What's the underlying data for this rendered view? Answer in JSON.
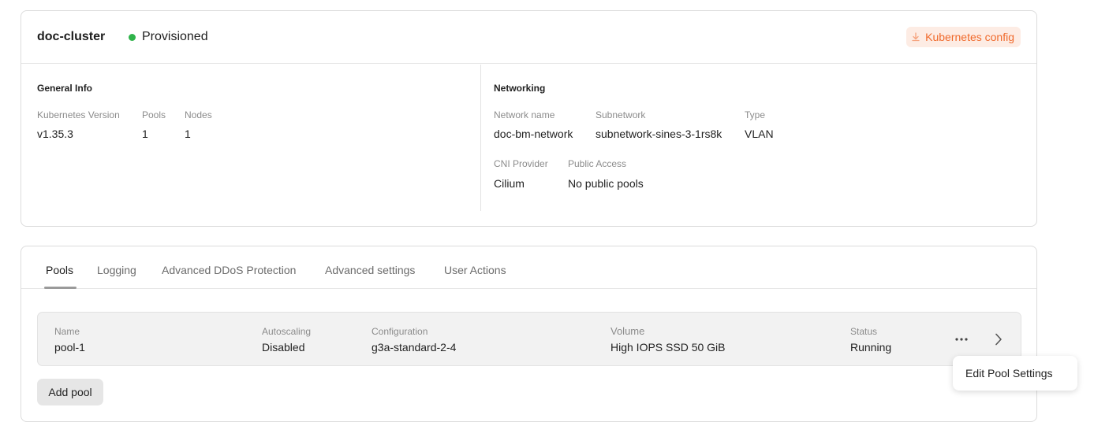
{
  "cluster": {
    "name": "doc-cluster",
    "status": "Provisioned",
    "status_color": "#2fb34a",
    "kube_config_label": "Kubernetes config",
    "kube_config_icon": "download-icon",
    "accent_color": "#f06a2c"
  },
  "general_info": {
    "title": "General Info",
    "fields": [
      {
        "label": "Kubernetes Version",
        "value": "v1.35.3"
      },
      {
        "label": "Pools",
        "value": "1"
      },
      {
        "label": "Nodes",
        "value": "1"
      }
    ]
  },
  "networking": {
    "title": "Networking",
    "fields": [
      {
        "label": "Network name",
        "value": "doc-bm-network"
      },
      {
        "label": "Subnetwork",
        "value": "subnetwork-sines-3-1rs8k"
      },
      {
        "label": "Type",
        "value": "VLAN"
      },
      {
        "label": "CNI Provider",
        "value": "Cilium"
      },
      {
        "label": "Public Access",
        "value": "No public pools"
      }
    ]
  },
  "tabs": [
    {
      "label": "Pools",
      "active": true
    },
    {
      "label": "Logging",
      "active": false
    },
    {
      "label": "Advanced DDoS Protection",
      "active": false
    },
    {
      "label": "Advanced settings",
      "active": false
    },
    {
      "label": "User Actions",
      "active": false
    }
  ],
  "pool": {
    "columns": [
      {
        "label": "Name",
        "value": "pool-1"
      },
      {
        "label": "Autoscaling",
        "value": "Disabled"
      },
      {
        "label": "Configuration",
        "value": "g3a-standard-2-4"
      },
      {
        "label": "Volume",
        "value": "High IOPS SSD 50 GiB"
      },
      {
        "label": "Status",
        "value": "Running"
      }
    ],
    "more_icon": "more-horizontal-icon",
    "chevron_icon": "chevron-right-icon"
  },
  "add_pool_label": "Add pool",
  "menu": {
    "items": [
      {
        "label": "Edit Pool Settings"
      }
    ]
  }
}
